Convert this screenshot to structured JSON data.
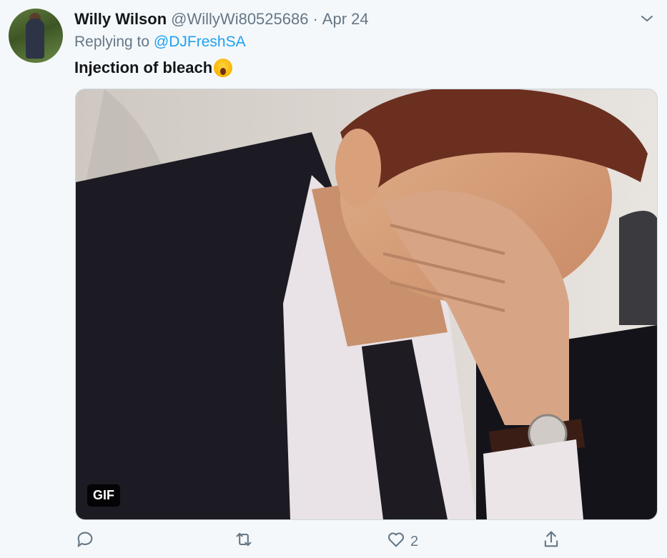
{
  "tweet": {
    "author_name": "Willy Wilson",
    "handle": "@WillyWi80525686",
    "separator": "·",
    "date": "Apr 24",
    "replying_prefix": "Replying to ",
    "replying_to": "@DJFreshSA",
    "text": "Injection of bleach",
    "emoji": "screaming-face-emoji"
  },
  "media": {
    "badge": "GIF"
  },
  "actions": {
    "reply_icon": "reply-icon",
    "retweet_icon": "retweet-icon",
    "like_icon": "heart-icon",
    "like_count": "2",
    "share_icon": "share-icon"
  },
  "colors": {
    "link": "#1da1f2",
    "secondary": "#657786",
    "background": "#f5f8fa"
  }
}
